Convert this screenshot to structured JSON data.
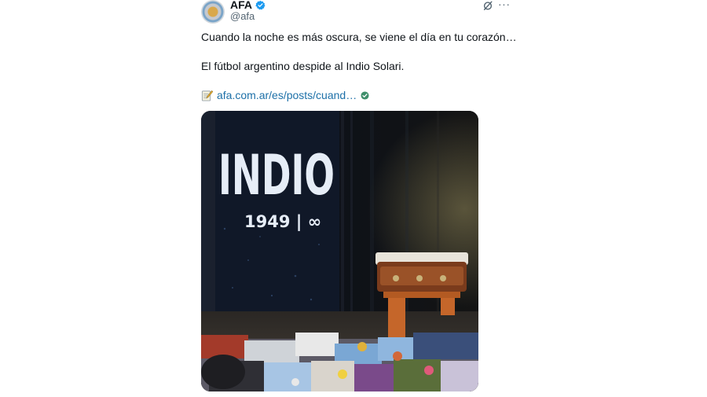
{
  "tweet": {
    "display_name": "AFA",
    "handle": "@afa",
    "verified_icon": "verified-badge-icon",
    "avatar_icon": "afa-crest-avatar",
    "line1": "Cuando la noche es más oscura, se viene el día en tu corazón…",
    "line2": "El fútbol argentino despide al Indio Solari.",
    "link_text": "afa.com.ar/es/posts/cuand…",
    "link_color": "#1d70a8"
  },
  "media": {
    "screen_title": "INDIO",
    "screen_years": "1949 | ∞"
  },
  "colors": {
    "text": "#0f1419",
    "secondary": "#536471",
    "verified": "#1d9bf0"
  }
}
